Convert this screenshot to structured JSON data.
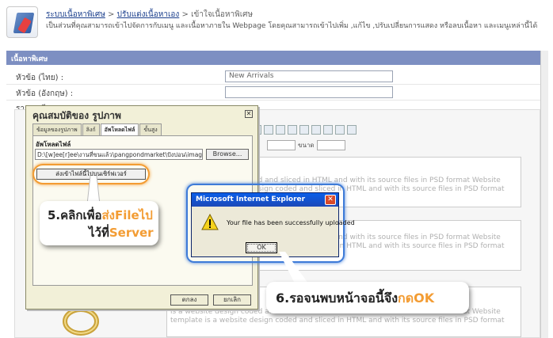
{
  "header": {
    "breadcrumb": [
      "ระบบเนื้อหาพิเศษ",
      "ปรับแต่งเนื้อหาเอง",
      "เข้าใจเนื้อหาพิเศษ"
    ],
    "separator": ">",
    "description": "เป็นส่วนที่คุณสามารถเข้าไปจัดการกับเมนู และเนื้อหาภายใน Webpage โดยคุณสามารถเข้าไปเพิ่ม ,แก้ไข ,ปรับเปลี่ยนการแสดง หรือลบเนื้อหา และเมนูเหล่านี้ได้"
  },
  "section": {
    "title": "เนื้อหาพิเศษ"
  },
  "form": {
    "title_th_label": "หัวข้อ (ไทย) :",
    "title_th_value": "New Arrivals",
    "title_en_label": "หัวข้อ (อังกฤษ) :",
    "title_en_value": "",
    "detail_label": "รายละเอียด"
  },
  "editor": {
    "size_label": "ขนาด",
    "cards": [
      "is a website design coded and sliced in HTML and with its source files in PSD format Website template is a website design coded and sliced in HTML and with its source files in PSD format",
      "is a website design coded and sliced in HTML and with its source files in PSD format Website template is a website design coded and sliced in HTML and with its source files in PSD format",
      "is a website design coded and sliced in HTML and with its source files in PSD format Website template is a website design coded and sliced in HTML and with its source files in PSD format"
    ]
  },
  "dialog": {
    "title": "คุณสมบัติของ รูปภาพ",
    "tabs": [
      "ข้อมูลของรูปภาพ",
      "ลิงก์",
      "อัพโหลดไฟล์",
      "ขั้นสูง"
    ],
    "active_tab": 2,
    "upload_label": "อัพโหลดไฟล์",
    "file_path": "D:\\[w]ee[r]ee\\งานที่ขนแล้ว\\pangpondmarket\\ปังปอน\\image\\2.jpg",
    "browse_label": "Browse...",
    "send_button": "ส่งเข้าไฟล์นี้ไปบนเซิร์ฟเวอร์",
    "ok_label": "ตกลง",
    "cancel_label": "ยกเลิก"
  },
  "callout1": {
    "prefix": "5.คลิกเพื่อ",
    "highlight": "ส่งFileไป",
    "line2_prefix": "ไว้ที่",
    "line2_highlight": "Server"
  },
  "msgbox": {
    "title": "Microsoft Internet Explorer",
    "message": "Your file has been successfully uploaded",
    "ok_label": "OK"
  },
  "callout2": {
    "prefix": "6.รอจนพบหน้าจอนี้จึง",
    "highlight": "กดOK"
  },
  "colors": {
    "accent_orange": "#f39c33",
    "accent_blue": "#3e7bd8",
    "section_bar": "#7d8fc2"
  }
}
